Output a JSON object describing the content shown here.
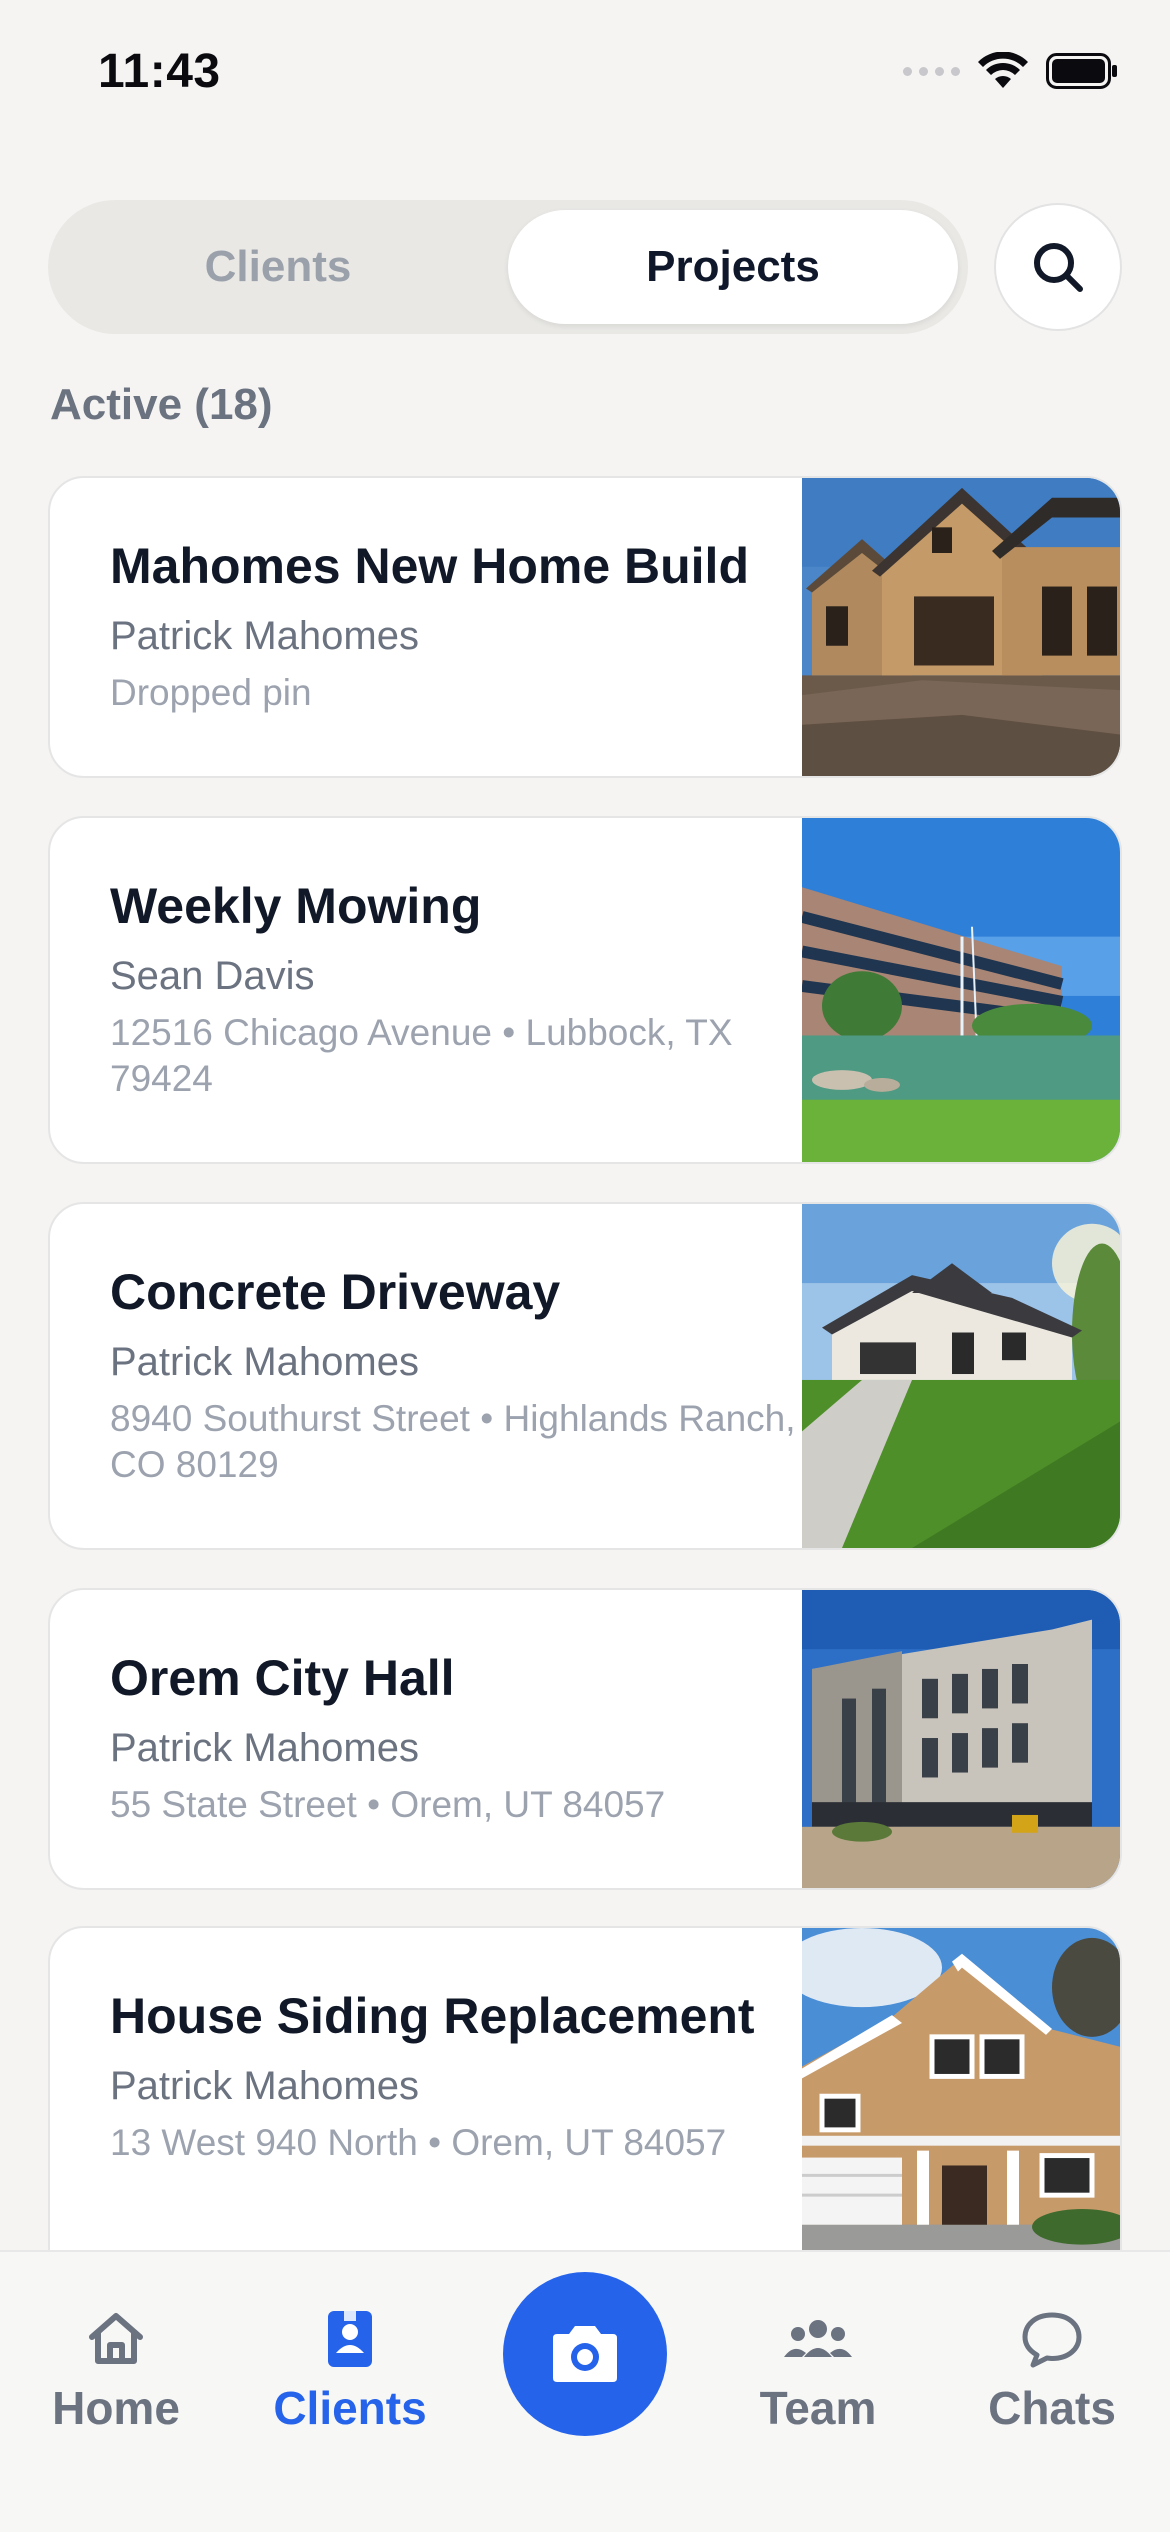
{
  "status": {
    "time": "11:43"
  },
  "segment": {
    "clients_label": "Clients",
    "projects_label": "Projects",
    "selected": "Projects"
  },
  "section": {
    "label": "Active (18)"
  },
  "projects": [
    {
      "title": "Mahomes New Home Build",
      "client": "Patrick Mahomes",
      "address": "Dropped pin",
      "image": "house-under-construction"
    },
    {
      "title": "Weekly Mowing",
      "client": "Sean Davis",
      "address": "12516 Chicago Avenue • Lubbock, TX 79424",
      "image": "office-building-pond"
    },
    {
      "title": "Concrete Driveway",
      "client": "Patrick Mahomes",
      "address": "8940 Southurst Street • Highlands Ranch, CO 80129",
      "image": "house-with-driveway"
    },
    {
      "title": "Orem City Hall",
      "client": "Patrick Mahomes",
      "address": "55 State Street • Orem, UT 84057",
      "image": "modern-building-construction"
    },
    {
      "title": "House Siding Replacement",
      "client": "Patrick Mahomes",
      "address": "13 West 940 North • Orem, UT 84057",
      "image": "house-siding"
    }
  ],
  "tabbar": {
    "home": "Home",
    "clients": "Clients",
    "team": "Team",
    "chats": "Chats",
    "active_tab": "Clients"
  },
  "colors": {
    "accent": "#2563eb",
    "background": "#f5f4f3"
  }
}
